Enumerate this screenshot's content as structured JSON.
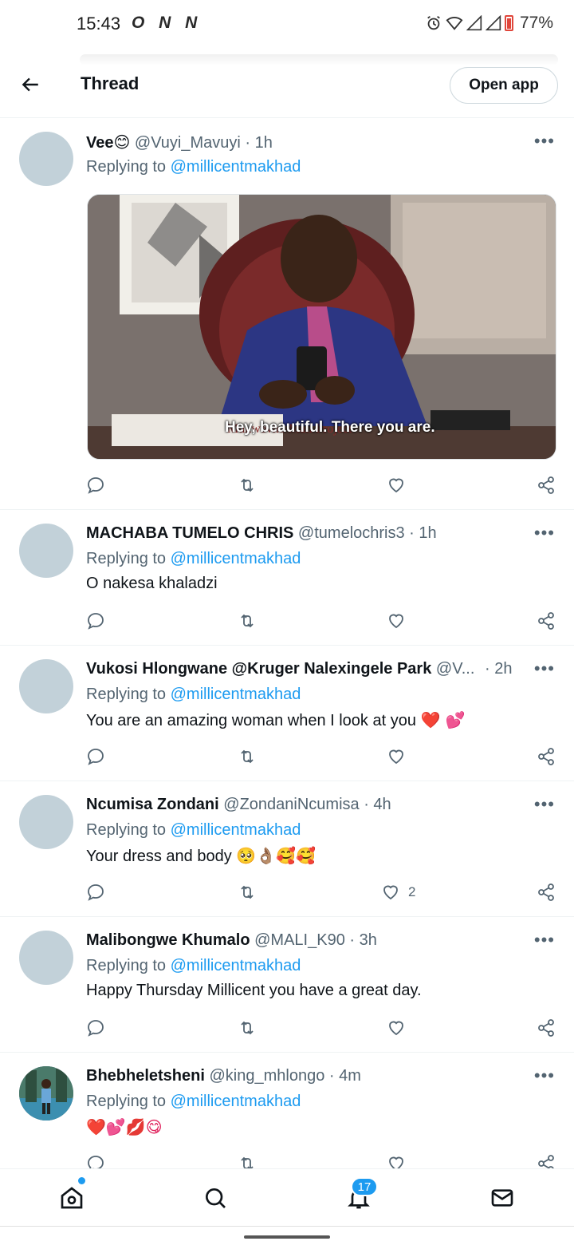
{
  "status_bar": {
    "time": "15:43",
    "notif_icons": "O N N",
    "battery_pct": "77%"
  },
  "header": {
    "title": "Thread",
    "open_app_label": "Open app"
  },
  "tweets": [
    {
      "name": "Vee",
      "name_emoji": "😊",
      "handle": "@Vuyi_Mavuyi",
      "time": "· 1h",
      "replying_prefix": "Replying to",
      "replying_to": "@millicentmakhad",
      "text": "",
      "media_caption": "Hey, beautiful. There you are.",
      "media_sign": "Mukwevho Mall Project",
      "likes": ""
    },
    {
      "name": "MACHABA TUMELO CHRIS",
      "handle": "@tumelochris3",
      "time": "· 1h",
      "replying_prefix": "Replying to",
      "replying_to": "@millicentmakhad",
      "text": "O nakesa khaladzi",
      "likes": ""
    },
    {
      "name": "Vukosi Hlongwane @Kruger Nalexingele Park",
      "handle": "@V...",
      "time": "· 2h",
      "replying_prefix": "Replying to",
      "replying_to": "@millicentmakhad",
      "text": "You are an amazing woman when I look at you",
      "text_emoji": "❤️ 💕",
      "likes": ""
    },
    {
      "name": "Ncumisa Zondani",
      "handle": "@ZondaniNcumisa",
      "time": "· 4h",
      "replying_prefix": "Replying to",
      "replying_to": "@millicentmakhad",
      "text": "Your dress and body",
      "text_emoji": "🥺👌🏽🥰🥰",
      "likes": "2"
    },
    {
      "name": "Malibongwe Khumalo",
      "handle": "@MALI_K90",
      "time": "· 3h",
      "replying_prefix": "Replying to",
      "replying_to": "@millicentmakhad",
      "text": "Happy Thursday Millicent you have a great day.",
      "likes": ""
    },
    {
      "name": "Bhebheletsheni",
      "handle": "@king_mhlongo",
      "time": "· 4m",
      "replying_prefix": "Replying to",
      "replying_to": "@millicentmakhad",
      "text": "",
      "text_emoji": "❤️💕💋😋",
      "likes": ""
    }
  ],
  "bottom_nav": {
    "notifications_badge": "17",
    "items": [
      "home-icon",
      "search-icon",
      "notifications-icon",
      "messages-icon"
    ]
  },
  "colors": {
    "accent": "#1d9bf0",
    "text": "#0f1419",
    "muted": "#536471",
    "avatar_placeholder": "#c2d1d9"
  }
}
